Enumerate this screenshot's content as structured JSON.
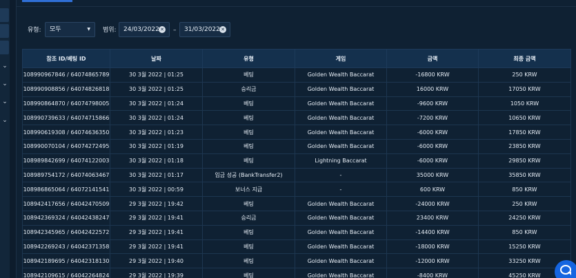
{
  "filters": {
    "type_label": "유형:",
    "type_value": "모두",
    "range_label": "범위:",
    "date_from": "24/03/2022",
    "date_separator": "–",
    "date_to": "31/03/2022"
  },
  "table": {
    "headers": [
      "참조 ID/베팅 ID",
      "날짜",
      "유형",
      "게임",
      "금액",
      "최종 금액"
    ],
    "rows": [
      [
        "108990967846 / 64074865789",
        "30 3월 2022 | 01:25",
        "베팅",
        "Golden Wealth Baccarat",
        "-16800 KRW",
        "250 KRW"
      ],
      [
        "108990908856 / 64074826818",
        "30 3월 2022 | 01:25",
        "승리금",
        "Golden Wealth Baccarat",
        "16000 KRW",
        "17050 KRW"
      ],
      [
        "108990864870 / 64074798005",
        "30 3월 2022 | 01:24",
        "베팅",
        "Golden Wealth Baccarat",
        "-9600 KRW",
        "1050 KRW"
      ],
      [
        "108990739633 / 64074715866",
        "30 3월 2022 | 01:24",
        "베팅",
        "Golden Wealth Baccarat",
        "-7200 KRW",
        "10650 KRW"
      ],
      [
        "108990619308 / 64074636350",
        "30 3월 2022 | 01:23",
        "베팅",
        "Golden Wealth Baccarat",
        "-6000 KRW",
        "17850 KRW"
      ],
      [
        "108990070104 / 64074272495",
        "30 3월 2022 | 01:19",
        "베팅",
        "Golden Wealth Baccarat",
        "-6000 KRW",
        "23850 KRW"
      ],
      [
        "108989842699 / 64074122003",
        "30 3월 2022 | 01:18",
        "베팅",
        "Lightning Baccarat",
        "-6000 KRW",
        "29850 KRW"
      ],
      [
        "108989754172 / 64074063467",
        "30 3월 2022 | 01:17",
        "입금 성공 (BankTransfer2)",
        "-",
        "35000 KRW",
        "35850 KRW"
      ],
      [
        "108986865064 / 64072141541",
        "30 3월 2022 | 00:59",
        "보너스 지급",
        "-",
        "600 KRW",
        "850 KRW"
      ],
      [
        "108942417656 / 64042470509",
        "29 3월 2022 | 19:42",
        "베팅",
        "Golden Wealth Baccarat",
        "-24000 KRW",
        "250 KRW"
      ],
      [
        "108942369324 / 64042438247",
        "29 3월 2022 | 19:41",
        "승리금",
        "Golden Wealth Baccarat",
        "23400 KRW",
        "24250 KRW"
      ],
      [
        "108942345965 / 64042422572",
        "29 3월 2022 | 19:41",
        "베팅",
        "Golden Wealth Baccarat",
        "-14400 KRW",
        "850 KRW"
      ],
      [
        "108942269243 / 64042371358",
        "29 3월 2022 | 19:41",
        "베팅",
        "Golden Wealth Baccarat",
        "-18000 KRW",
        "15250 KRW"
      ],
      [
        "108942189695 / 64042318130",
        "29 3월 2022 | 19:40",
        "베팅",
        "Golden Wealth Baccarat",
        "-12000 KRW",
        "33250 KRW"
      ],
      [
        "108942109615 / 64042264824",
        "29 3월 2022 | 19:39",
        "베팅",
        "Golden Wealth Baccarat",
        "-8400 KRW",
        "45250 KRW"
      ]
    ]
  },
  "icons": {
    "sidebar_chevron": "chevron-down-icon",
    "chat": "chat-bubble-icon"
  },
  "colors": {
    "accent": "#2f6fd6",
    "chat_button": "#1565e0",
    "background": "#0f2133"
  }
}
